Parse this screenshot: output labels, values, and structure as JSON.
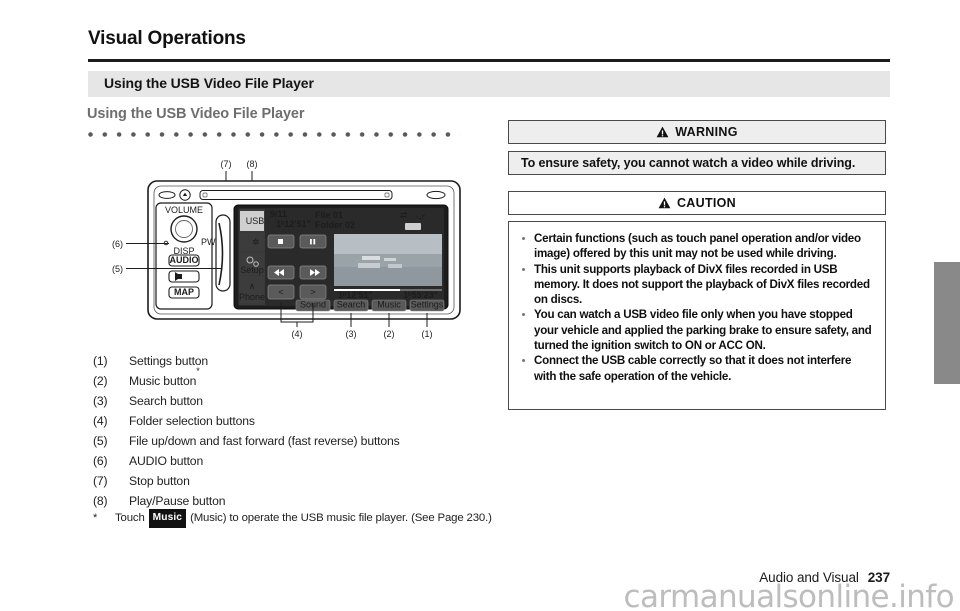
{
  "document": {
    "page_title": "Visual Operations",
    "section_bar_label": "Using the USB Video File Player",
    "sub_heading": "Using the USB Video File Player",
    "footer_section": "Audio and Visual",
    "footer_page": "237",
    "watermark": "carmanualsonline.info"
  },
  "warning": {
    "head_label": "WARNING",
    "body": "To ensure safety, you cannot watch a video while driving."
  },
  "caution": {
    "head_label": "CAUTION",
    "items": [
      "Certain functions (such as touch panel operation and/or video image) offered by this unit may not be used while driving.",
      "This unit supports playback of DivX files recorded in USB memory. It does not support the playback of DivX files recorded on discs.",
      "You can watch a USB video file only when you have stopped your vehicle and applied the parking brake to ensure safety, and turned the ignition switch to ON or ACC ON.",
      "Connect the USB cable correctly so that it does not interfere with the safe operation of the vehicle."
    ]
  },
  "callout_list": [
    {
      "index": "(1)",
      "label": "Settings button",
      "star": ""
    },
    {
      "index": "(2)",
      "label": "Music button",
      "star": "*"
    },
    {
      "index": "(3)",
      "label": "Search button",
      "star": ""
    },
    {
      "index": "(4)",
      "label": "Folder selection buttons",
      "star": ""
    },
    {
      "index": "(5)",
      "label": "File up/down and fast forward (fast reverse) buttons",
      "star": ""
    },
    {
      "index": "(6)",
      "label": "AUDIO button",
      "star": ""
    },
    {
      "index": "(7)",
      "label": "Stop button",
      "star": ""
    },
    {
      "index": "(8)",
      "label": "Play/Pause button",
      "star": ""
    }
  ],
  "footnote": {
    "marker": "*",
    "before": "Touch",
    "chip": "Music",
    "after": "(Music) to operate the USB music file player. (See Page 230.)"
  },
  "illustration": {
    "callout_labels": {
      "c1": "(1)",
      "c2": "(2)",
      "c3": "(3)",
      "c4": "(4)",
      "c5": "(5)",
      "c6": "(6)",
      "c7": "(7)",
      "c8": "(8)"
    },
    "hard_buttons": {
      "volume": "VOLUME",
      "power": "PWR",
      "disp": "DISP",
      "audio": "AUDIO",
      "map": "MAP"
    },
    "screen": {
      "source_tab": "USB",
      "setup_tab": "Setup",
      "phone_tab": "Phone",
      "track_count": "9/11",
      "elapsed_top": "1ʰ 12' 51\"",
      "file_name": "File 01",
      "folder_name": "Folder 02",
      "elapsed_bottom": "1ʰ 12' 51\"",
      "total_time": "1ʰ 55' 23\"",
      "soft_keys": [
        {
          "name": "sound",
          "label": "Sound"
        },
        {
          "name": "search",
          "label": "Search"
        },
        {
          "name": "music",
          "label": "Music"
        },
        {
          "name": "settings",
          "label": "Settings"
        }
      ]
    }
  },
  "colors": {
    "section_bar": "#e6e6e6",
    "box_border": "#4a4a4a",
    "box_fill": "#eeeeee",
    "edge_tab": "#898989",
    "sub_heading": "#6e6e6e",
    "watermark": "#bdbdbd"
  }
}
